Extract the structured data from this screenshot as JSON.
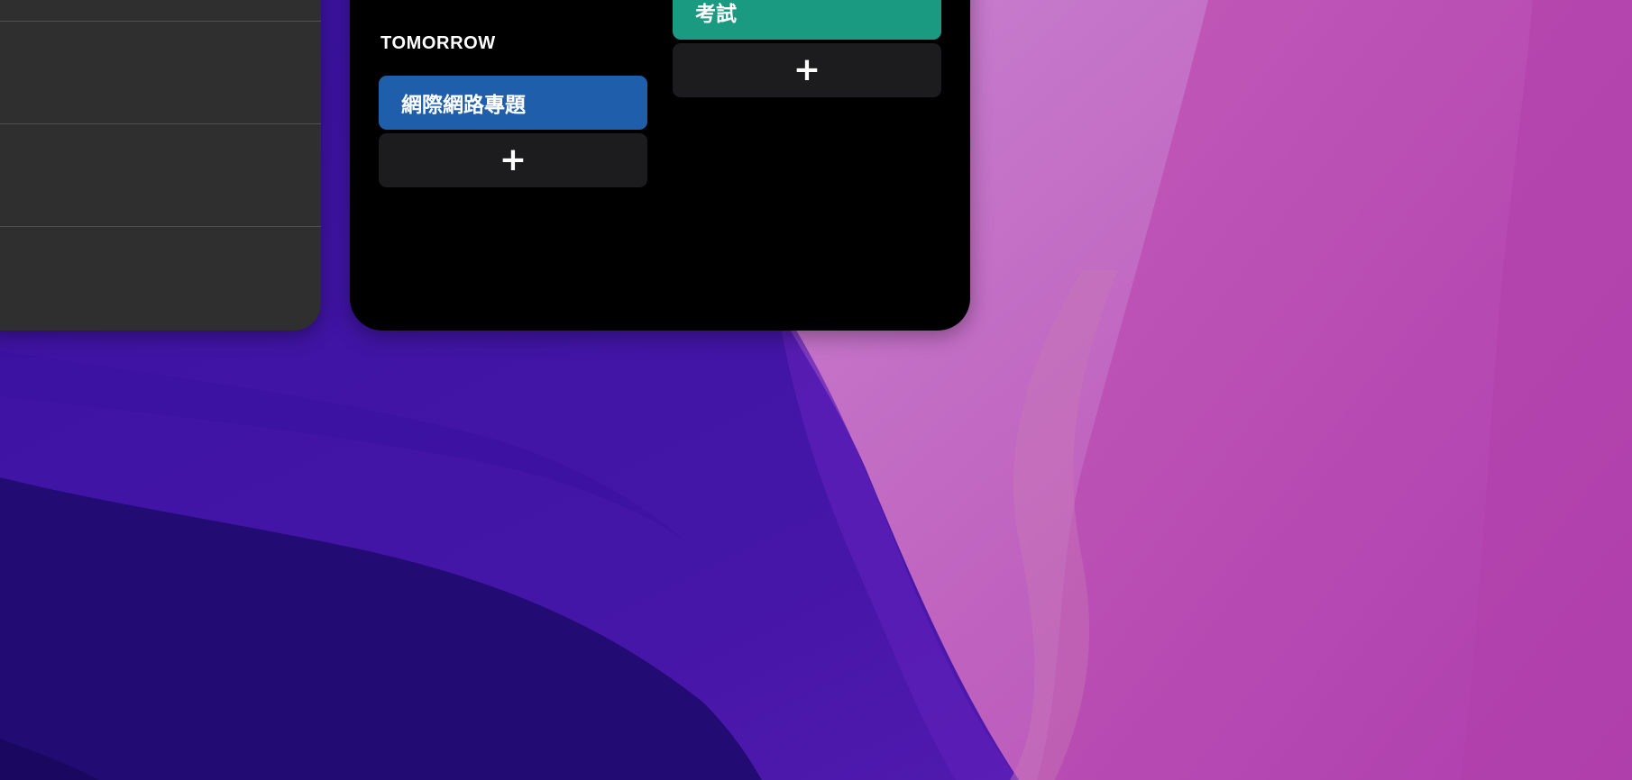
{
  "widget": {
    "section_label": "TOMORROW",
    "col1": {
      "event_title": "網際網路專題",
      "event_color": "#1f5eaa",
      "add_label": "+"
    },
    "col2": {
      "event_title": "考試",
      "event_color": "#1a9a80",
      "add_label": "+"
    }
  },
  "icons": {
    "add": "plus-icon"
  }
}
